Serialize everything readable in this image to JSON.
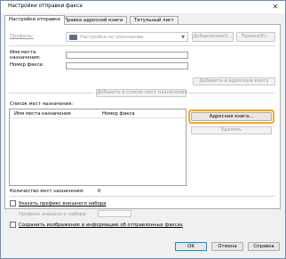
{
  "window": {
    "title": "Настройки отправки факса",
    "close_glyph": "✕"
  },
  "tabs": [
    {
      "label": "Настройки отправки",
      "active": true
    },
    {
      "label": "Правка адресной книги",
      "active": false
    },
    {
      "label": "Титульный лист",
      "active": false
    }
  ],
  "profile": {
    "label": "Профиль:",
    "value": "Настройки по умолчанию",
    "add_button": "Добавление(I)...",
    "edit_button": "Правка(Е)..."
  },
  "destination": {
    "name_label": "Имя места назначения:",
    "fax_label": "Номер факса:",
    "name_value": "",
    "fax_value": "",
    "add_to_book_button": "Добавить в адресную книгу",
    "add_to_list_button": "Добавить в список мест назначения"
  },
  "dest_list": {
    "label": "Список мест назначения:",
    "columns": [
      "Имя места назначения",
      "Номер факса"
    ],
    "rows": [],
    "address_book_button": "Адресная книга...",
    "delete_button": "Удалить"
  },
  "count": {
    "label": "Количество мест назначения:",
    "value": "0"
  },
  "prefix": {
    "checkbox_label": "Указать префикс внешнего набора",
    "field_label": "Префикс внешнего набора:",
    "value": ""
  },
  "save": {
    "checkbox_label": "Сохранить изображение и информацию об отправленных факсах"
  },
  "footer": {
    "ok": "OK",
    "cancel": "Отмена",
    "help": "Справка"
  },
  "colors": {
    "highlight": "#f7a530",
    "window_bg": "#f0f0f0",
    "panel_bg": "#ffffff"
  }
}
